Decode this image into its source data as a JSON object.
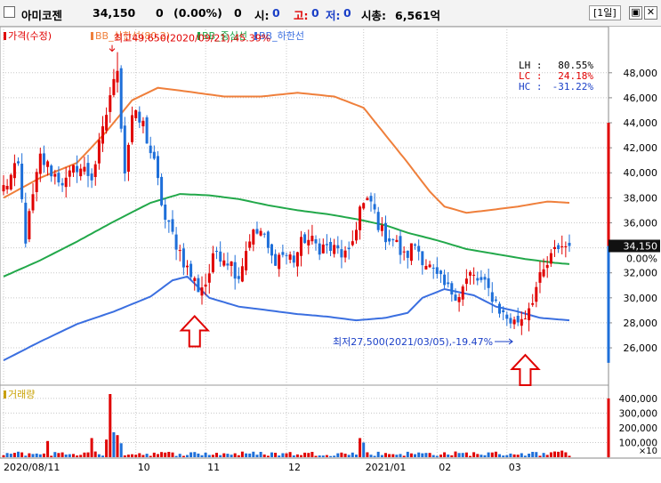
{
  "header": {
    "name": "아미코젠",
    "price": "34,150",
    "change": "0",
    "change_pct": "(0.00%)",
    "volume": "0",
    "open_label": "시:",
    "open_val": "0",
    "high_label": "고:",
    "high_val": "0",
    "low_label": "저:",
    "low_val": "0",
    "mcap_label": "시총:",
    "mcap_val": "6,561억",
    "period_button": "[1일]",
    "window_button_1": "▣",
    "window_button_2": "✕"
  },
  "colors": {
    "up": "#e00000",
    "down": "#1e6fd9",
    "bb_upper": "#ef7f3b",
    "bb_mid": "#22a84a",
    "bb_lower": "#3b6fe0",
    "grid": "#c8c8c8"
  },
  "chart_data": [
    {
      "type": "candlestick",
      "legend": [
        {
          "label": "가격(수정)",
          "color": "#e00000"
        },
        {
          "label": "BB_상한선(80,2)",
          "color": "#ef7f3b"
        },
        {
          "label": "BB_중심선",
          "color": "#22a84a"
        },
        {
          "label": "BB_하한선",
          "color": "#3b6fe0"
        }
      ],
      "y_ticks": [
        26000,
        28000,
        30000,
        32000,
        34000,
        36000,
        38000,
        40000,
        42000,
        44000,
        46000,
        48000
      ],
      "y_tick_labels": [
        "26,000",
        "28,000",
        "30,000",
        "32,000",
        "34,000",
        "36,000",
        "38,000",
        "40,000",
        "42,000",
        "44,000",
        "46,000",
        "48,000"
      ],
      "ylim": [
        23300,
        51400
      ],
      "x_labels": [
        "2020/08/11",
        "10",
        "11",
        "12",
        "2021/01",
        "02",
        "03"
      ],
      "x_label_positions": [
        0,
        36,
        55,
        77,
        98,
        118,
        137
      ],
      "n_bars": 155,
      "last_price_label": "34,150",
      "last_change_label": "0.00%",
      "stats": [
        {
          "label": "LH :",
          "value": "80.55%",
          "color": "#000000"
        },
        {
          "label": "LC :",
          "value": "24.18%",
          "color": "#e00000"
        },
        {
          "label": "HC :",
          "value": "-31.22%",
          "color": "#1a3fc7"
        }
      ],
      "annotations": {
        "high": "최고49,650(2020/09/21),45.39%",
        "high_index": 31,
        "high_value": 49650,
        "low": "최저27,500(2021/03/05),-19.47%",
        "low_index": 139,
        "low_value": 27500
      },
      "arrow_markers": [
        {
          "index": 52,
          "value": 29100
        },
        {
          "index": 142,
          "value": 26000
        }
      ],
      "close_path": [
        [
          0,
          38800
        ],
        [
          4,
          40500
        ],
        [
          6,
          34800
        ],
        [
          10,
          41200
        ],
        [
          14,
          39800
        ],
        [
          17,
          39200
        ],
        [
          20,
          40600
        ],
        [
          24,
          39700
        ],
        [
          27,
          43200
        ],
        [
          29,
          46300
        ],
        [
          31,
          47800
        ],
        [
          33,
          40200
        ],
        [
          35,
          44600
        ],
        [
          38,
          43800
        ],
        [
          41,
          40600
        ],
        [
          44,
          36200
        ],
        [
          47,
          34400
        ],
        [
          50,
          32300
        ],
        [
          53,
          30800
        ],
        [
          55,
          31200
        ],
        [
          58,
          33800
        ],
        [
          61,
          33100
        ],
        [
          64,
          31800
        ],
        [
          67,
          34900
        ],
        [
          70,
          35300
        ],
        [
          73,
          33100
        ],
        [
          76,
          33500
        ],
        [
          79,
          33100
        ],
        [
          82,
          34800
        ],
        [
          85,
          34200
        ],
        [
          88,
          34000
        ],
        [
          91,
          33700
        ],
        [
          94,
          33200
        ],
        [
          97,
          37200
        ],
        [
          100,
          37600
        ],
        [
          103,
          35200
        ],
        [
          106,
          34700
        ],
        [
          109,
          33200
        ],
        [
          112,
          34300
        ],
        [
          115,
          32800
        ],
        [
          118,
          31500
        ],
        [
          121,
          30600
        ],
        [
          124,
          30400
        ],
        [
          127,
          31800
        ],
        [
          130,
          31200
        ],
        [
          133,
          30200
        ],
        [
          136,
          28600
        ],
        [
          139,
          28000
        ],
        [
          142,
          28700
        ],
        [
          145,
          30800
        ],
        [
          148,
          32600
        ],
        [
          151,
          34150
        ],
        [
          154,
          34150
        ]
      ],
      "bb_upper": [
        [
          0,
          38000
        ],
        [
          10,
          39600
        ],
        [
          20,
          40800
        ],
        [
          28,
          43300
        ],
        [
          35,
          45800
        ],
        [
          42,
          46800
        ],
        [
          50,
          46500
        ],
        [
          60,
          46100
        ],
        [
          70,
          46100
        ],
        [
          80,
          46400
        ],
        [
          90,
          46100
        ],
        [
          98,
          45200
        ],
        [
          104,
          43000
        ],
        [
          110,
          40800
        ],
        [
          116,
          38500
        ],
        [
          120,
          37300
        ],
        [
          126,
          36800
        ],
        [
          132,
          37000
        ],
        [
          140,
          37300
        ],
        [
          148,
          37700
        ],
        [
          154,
          37600
        ]
      ],
      "bb_mid": [
        [
          0,
          31700
        ],
        [
          10,
          33000
        ],
        [
          20,
          34500
        ],
        [
          30,
          36100
        ],
        [
          40,
          37600
        ],
        [
          48,
          38300
        ],
        [
          56,
          38200
        ],
        [
          64,
          37900
        ],
        [
          72,
          37400
        ],
        [
          80,
          37000
        ],
        [
          88,
          36700
        ],
        [
          96,
          36300
        ],
        [
          104,
          35800
        ],
        [
          110,
          35200
        ],
        [
          118,
          34600
        ],
        [
          126,
          33900
        ],
        [
          134,
          33500
        ],
        [
          142,
          33100
        ],
        [
          150,
          32800
        ],
        [
          154,
          32700
        ]
      ],
      "bb_lower": [
        [
          0,
          25000
        ],
        [
          10,
          26500
        ],
        [
          20,
          27900
        ],
        [
          30,
          28900
        ],
        [
          40,
          30100
        ],
        [
          46,
          31400
        ],
        [
          50,
          31700
        ],
        [
          56,
          30000
        ],
        [
          64,
          29300
        ],
        [
          72,
          29000
        ],
        [
          80,
          28700
        ],
        [
          88,
          28500
        ],
        [
          96,
          28200
        ],
        [
          104,
          28400
        ],
        [
          110,
          28800
        ],
        [
          114,
          30000
        ],
        [
          120,
          30700
        ],
        [
          128,
          30200
        ],
        [
          134,
          29300
        ],
        [
          140,
          28900
        ],
        [
          146,
          28400
        ],
        [
          154,
          28200
        ]
      ]
    },
    {
      "type": "bar",
      "label": "거래량",
      "y_ticks": [
        100000,
        200000,
        300000,
        400000
      ],
      "y_tick_labels": [
        "100,000",
        "200,000",
        "300,000",
        "400,000"
      ],
      "ylim": [
        0,
        460000
      ],
      "unit_label": "×10",
      "spikes": [
        {
          "index": 29,
          "value": 430000,
          "up": true
        },
        {
          "index": 30,
          "value": 170000,
          "up": false
        },
        {
          "index": 28,
          "value": 120000,
          "up": true
        },
        {
          "index": 31,
          "value": 150000,
          "up": true
        },
        {
          "index": 32,
          "value": 95000,
          "up": false
        },
        {
          "index": 12,
          "value": 110000,
          "up": true
        },
        {
          "index": 24,
          "value": 130000,
          "up": true
        },
        {
          "index": 97,
          "value": 130000,
          "up": true
        },
        {
          "index": 98,
          "value": 100000,
          "up": false
        },
        {
          "index": 152,
          "value": 45000,
          "up": true
        }
      ]
    }
  ]
}
